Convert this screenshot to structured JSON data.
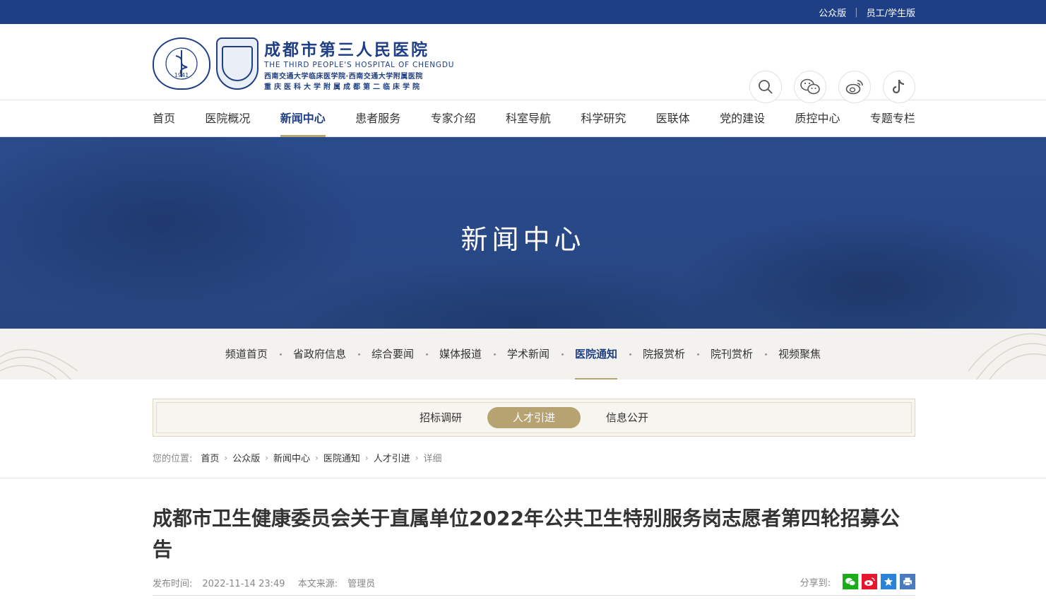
{
  "topbar": {
    "public_version": "公众版",
    "staff_version": "员工/学生版"
  },
  "logo": {
    "seal_year": "1941",
    "cn_name": "成都市第三人民医院",
    "en_name": "THE THIRD PEOPLE'S HOSPITAL OF CHENGDU",
    "affiliation_1": "西南交通大学临床医学院·西南交通大学附属医院",
    "affiliation_2": "重庆医科大学附属成都第二临床学院"
  },
  "header_icons": [
    "search-icon",
    "wechat-icon",
    "weibo-icon",
    "tiktok-icon"
  ],
  "nav": {
    "items": [
      {
        "label": "首页"
      },
      {
        "label": "医院概况"
      },
      {
        "label": "新闻中心"
      },
      {
        "label": "患者服务"
      },
      {
        "label": "专家介绍"
      },
      {
        "label": "科室导航"
      },
      {
        "label": "科学研究"
      },
      {
        "label": "医联体"
      },
      {
        "label": "党的建设"
      },
      {
        "label": "质控中心"
      },
      {
        "label": "专题专栏"
      }
    ],
    "active": "新闻中心"
  },
  "banner": {
    "title": "新闻中心"
  },
  "subnav": {
    "items": [
      {
        "label": "频道首页"
      },
      {
        "label": "省政府信息"
      },
      {
        "label": "综合要闻"
      },
      {
        "label": "媒体报道"
      },
      {
        "label": "学术新闻"
      },
      {
        "label": "医院通知"
      },
      {
        "label": "院报赏析"
      },
      {
        "label": "院刊赏析"
      },
      {
        "label": "视频聚焦"
      }
    ],
    "active": "医院通知"
  },
  "tabs": {
    "items": [
      {
        "label": "招标调研"
      },
      {
        "label": "人才引进"
      },
      {
        "label": "信息公开"
      }
    ],
    "active": "人才引进"
  },
  "breadcrumb": {
    "label": "您的位置:",
    "items": [
      "首页",
      "公众版",
      "新闻中心",
      "医院通知",
      "人才引进"
    ],
    "current": "详细"
  },
  "article": {
    "title": "成都市卫生健康委员会关于直属单位2022年公共卫生特别服务岗志愿者第四轮招募公告",
    "publish_label": "发布时间:",
    "publish_time": "2022-11-14 23:49",
    "source_label": "本文来源:",
    "source": "管理员",
    "share_label": "分享到:"
  },
  "colors": {
    "primary": "#1e3f85",
    "accent": "#b7a271",
    "wechat": "#1aad19",
    "weibo": "#e6162d",
    "qzone": "#2b82d9",
    "print": "#4a7bc1"
  }
}
